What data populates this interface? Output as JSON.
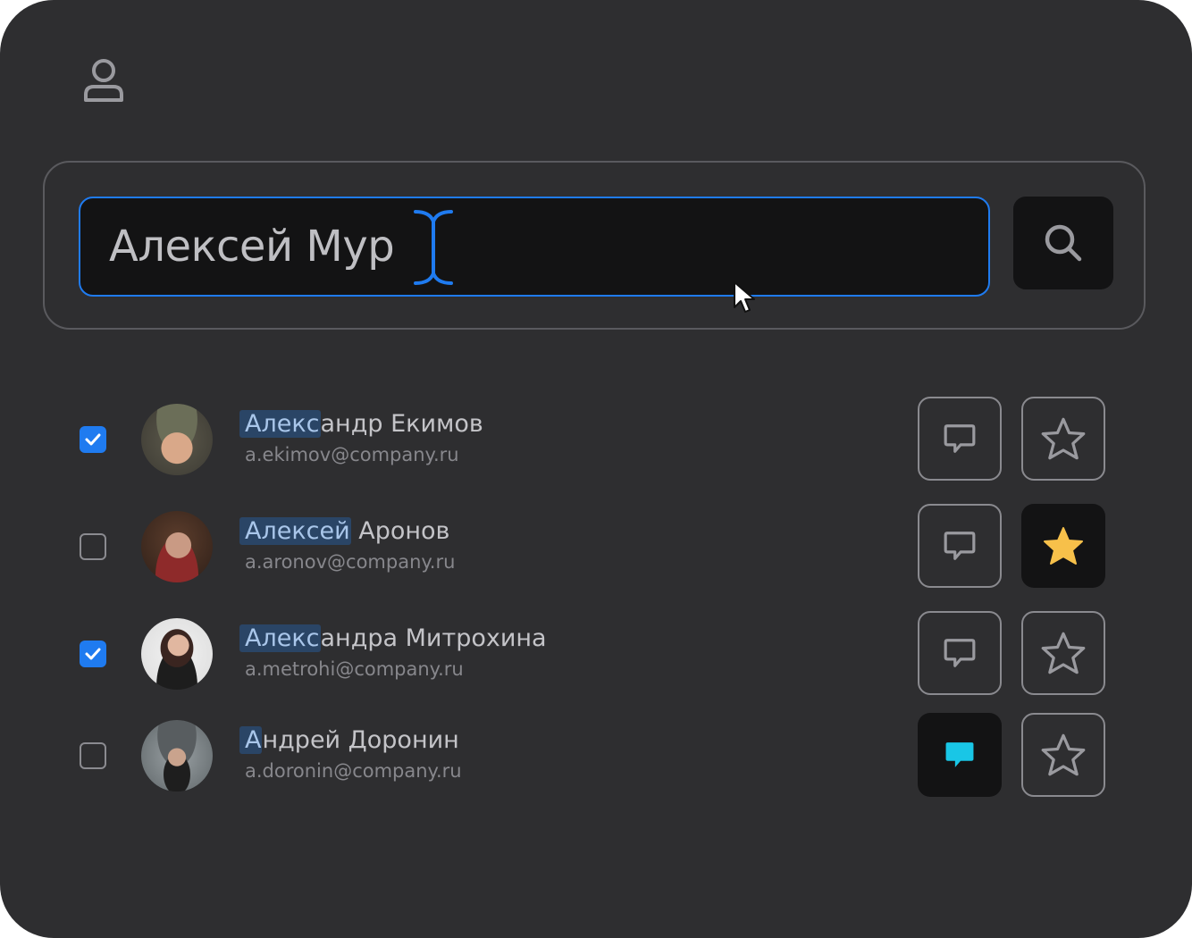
{
  "header": {
    "icon": "user-icon"
  },
  "search": {
    "value": "Алексей Мур",
    "button_icon": "search-icon"
  },
  "colors": {
    "background": "#2e2e30",
    "accent": "#1f7bf0",
    "highlight": "#2a4566",
    "star_active": "#f7c04a",
    "chat_active": "#19c6e6"
  },
  "contacts": [
    {
      "match": "Алекс",
      "rest": "андр Екимов",
      "email": "a.ekimov@company.ru",
      "checked": true,
      "chat_active": false,
      "favorite": false
    },
    {
      "match": "Алексей",
      "rest": " Аронов",
      "email": "a.aronov@company.ru",
      "checked": false,
      "chat_active": false,
      "favorite": true
    },
    {
      "match": "Алекс",
      "rest": "андра Митрохина",
      "email": "a.metrohi@company.ru",
      "checked": true,
      "chat_active": false,
      "favorite": false
    },
    {
      "match": "А",
      "rest": "ндрей Доронин",
      "email": "a.doronin@company.ru",
      "checked": false,
      "chat_active": true,
      "favorite": false
    }
  ]
}
